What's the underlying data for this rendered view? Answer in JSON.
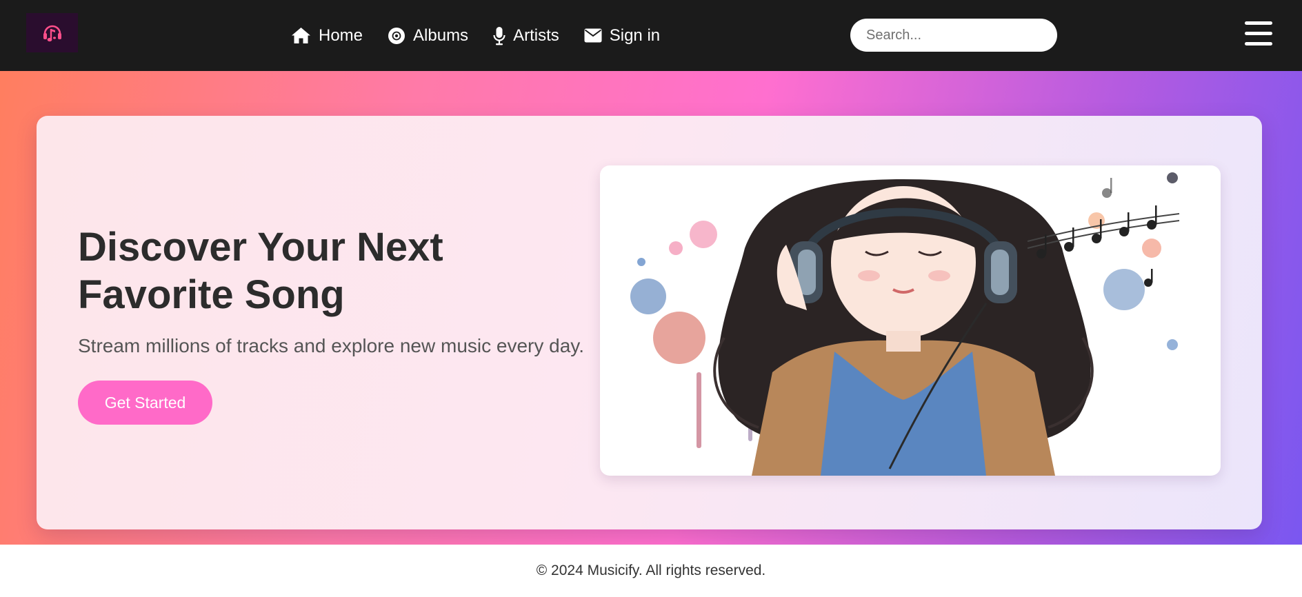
{
  "app": {
    "logo_icon": "headphones-music-note-icon",
    "colors": {
      "nav_bg": "#1b1b1b",
      "accent": "#ff6ac8",
      "gradient": [
        "#ff7e5f",
        "#ff6fcf",
        "#7a57f0"
      ],
      "text_dark": "#2c2c2c"
    }
  },
  "nav": {
    "items": [
      {
        "label": "Home",
        "icon": "home-icon"
      },
      {
        "label": "Albums",
        "icon": "disc-icon"
      },
      {
        "label": "Artists",
        "icon": "microphone-icon"
      },
      {
        "label": "Sign in",
        "icon": "envelope-icon"
      }
    ],
    "search_placeholder": "Search...",
    "menu_icon": "hamburger-menu-icon"
  },
  "hero": {
    "title": "Discover Your Next Favorite Song",
    "subtitle": "Stream millions of tracks and explore new music every day.",
    "cta_label": "Get Started",
    "image_icon": "girl-with-headphones-illustration"
  },
  "footer": {
    "text": "© 2024 Musicify. All rights reserved."
  }
}
